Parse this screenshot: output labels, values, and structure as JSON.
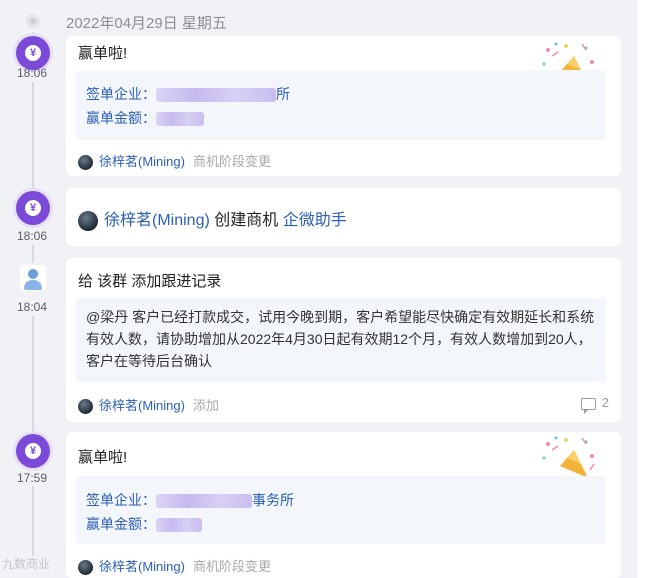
{
  "date_header": {
    "text": "2022年04月29日 星期五"
  },
  "entries": [
    {
      "time": "18:06",
      "title": "赢单啦!",
      "field1_label": "签单企业：",
      "field1_suffix": "所",
      "field2_label": "赢单金额：",
      "author": "徐梓茗(Mining)",
      "action": "商机阶段变更"
    },
    {
      "time": "18:06",
      "author": "徐梓茗(Mining)",
      "verb": "创建商机",
      "source": "企微助手"
    },
    {
      "time": "18:04",
      "title": "给 该群 添加跟进记录",
      "note": "@梁丹 客户已经打款成交，试用今晚到期，客户希望能尽快确定有效期延长和系统有效人数，请协助增加从2022年4月30日起有效期12个月，有效人数增加到20人，客户在等待后台确认",
      "author": "徐梓茗(Mining)",
      "action": "添加",
      "comment_count": "2"
    },
    {
      "time": "17:59",
      "title": "赢单啦!",
      "field1_label": "签单企业：",
      "field1_suffix": "事务所",
      "field2_label": "赢单金额：",
      "author": "徐梓茗(Mining)",
      "action": "商机阶段变更"
    }
  ],
  "watermark": "九数商业",
  "colors": {
    "accent": "#7b4ad8",
    "link": "#2b5fb3",
    "background": "#f1f2f5"
  }
}
